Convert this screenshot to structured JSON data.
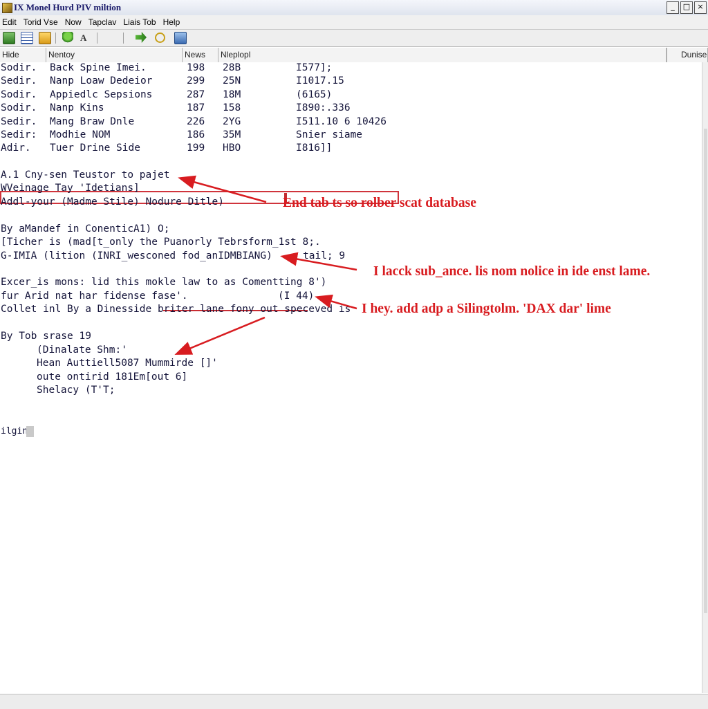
{
  "window": {
    "title": "IX Monel Hurd PIV miltion",
    "controls": [
      "_",
      "□",
      "×"
    ]
  },
  "menu": [
    "Edit",
    "Torid Vse",
    "Now",
    "Tapclav",
    "Liais Tob",
    "Help"
  ],
  "toolbar": {
    "icons": [
      "save-icon",
      "table-icon",
      "folder-icon",
      "pin-icon",
      "text-icon",
      "forward-icon",
      "search-icon",
      "bookmark-icon"
    ]
  },
  "columns": {
    "c1": "Hide",
    "c2": "Nentoy",
    "c3": "News",
    "c4": "Nleplopl",
    "c5": "Dunise"
  },
  "rows": [
    {
      "a": "Sodir.",
      "b": "Back Spine Imei.",
      "c": "198",
      "d": "28B",
      "e": "I577];"
    },
    {
      "a": "Sedir.",
      "b": "Nanp Loaw Dedeior",
      "c": "299",
      "d": "25N",
      "e": "I1017.15"
    },
    {
      "a": "Sodir.",
      "b": "Appiedlc Sepsions",
      "c": "287",
      "d": "18M",
      "e": "(6165)"
    },
    {
      "a": "Sodir.",
      "b": "Nanp Kins",
      "c": "187",
      "d": "158",
      "e": "I890:.336"
    },
    {
      "a": "Sedir.",
      "b": "Mang Braw Dnle",
      "c": "226",
      "d": "2YG",
      "e": "I511.10 6 10426"
    },
    {
      "a": "Sedir:",
      "b": "Modhie NOM",
      "c": "186",
      "d": "35M",
      "e": "Snier siame"
    },
    {
      "a": "Adir.",
      "b": "Tuer Drine Side",
      "c": "199",
      "d": "HBO",
      "e": "I816]]"
    }
  ],
  "lines": {
    "l1": "A.1 Cny-sen Teustor to pajet",
    "l2": "WVeinage Tay 'Idetians]",
    "l3": "Addl-your (Madme Stile) Nodure Ditle)",
    "l4": "By aMandef in ConenticA1) O;",
    "l5": "[Ticher is (mad[t_only the Puanorly Tebrsform_1st 8;.",
    "l6": "G-IMIA (lition (INRI_wesconed fod_anIDMBIANG)",
    "l6b": "tail; 9",
    "l7": "Excer_is mons: lid this mokle law to as Comentting 8')",
    "l8": "fur Arid nat har fidense fase'.",
    "l8b": "(I 44)",
    "l9": "Collet inl By a Dinesside briter lane fony out speceved is",
    "l10": "By Tob srase 19",
    "l11": "(Dinalate Shm:'",
    "l12": "Hean Auttiell5087 Mummirde []'",
    "l13": "oute ontirid 181Em[out 6]",
    "l14": "Shelacy (T'T;",
    "prompt": "ilgin"
  },
  "annotations": {
    "a1": "End tab ts so rolber scat database",
    "a2": "I lacck sub_ance. lis nom nolice in ide enst lame.",
    "a3": "I hey. add adp a Silingtolm. 'DAX dar' lime"
  },
  "colors": {
    "annotation": "#d81c20",
    "selection": "#d0343c",
    "text": "#14143a"
  }
}
